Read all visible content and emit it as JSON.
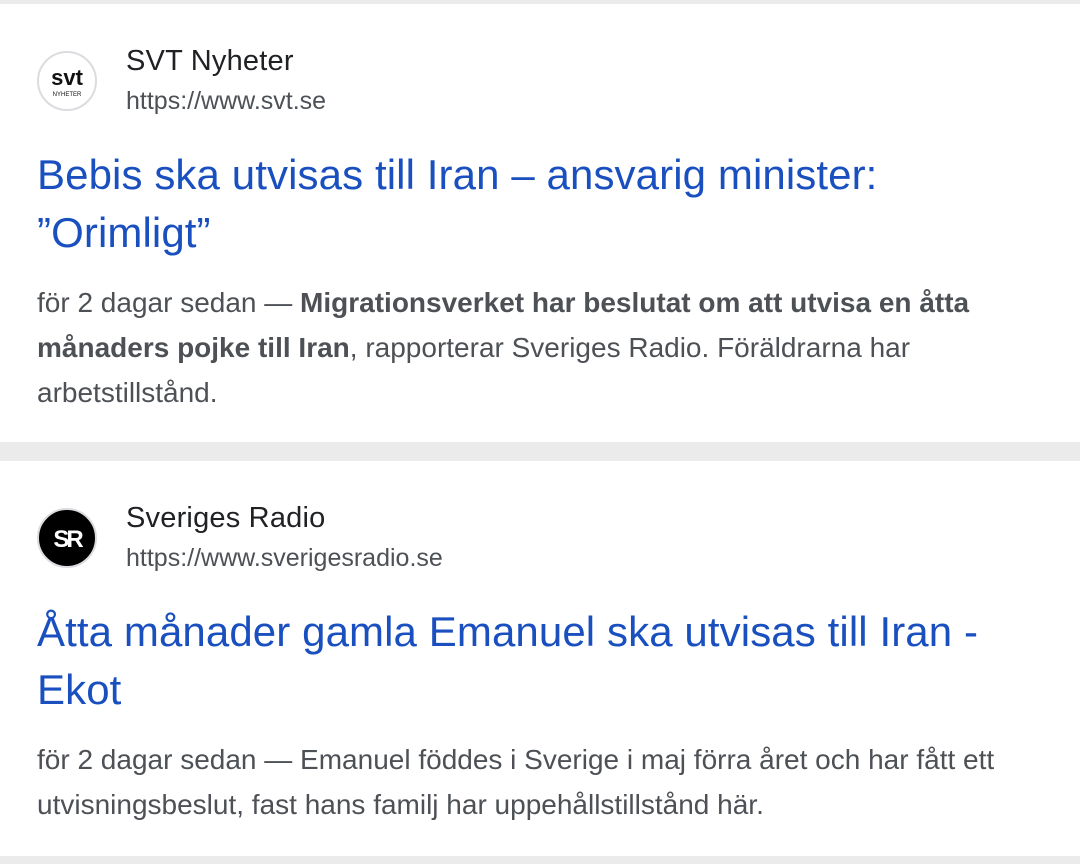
{
  "results": [
    {
      "site_name": "SVT Nyheter",
      "url": "https://www.svt.se",
      "favicon": {
        "icon": "svt-logo-icon",
        "text_main": "svt",
        "text_sub": "NYHETER"
      },
      "title_line1": "Bebis ska utvisas till Iran – ansvarig minister:",
      "title_line2": "”Orimligt”",
      "snippet": {
        "date": "för 2 dagar sedan — ",
        "bold": "Migrationsverket har beslutat om att utvisa en åtta månaders pojke till Iran",
        "rest": ", rapporterar Sveriges Radio. Föräldrarna har arbetstillstånd."
      }
    },
    {
      "site_name": "Sveriges Radio",
      "url": "https://www.sverigesradio.se",
      "favicon": {
        "icon": "sveriges-radio-logo-icon",
        "text_main": "SR"
      },
      "title_line1": "Åtta månader gamla Emanuel ska utvisas till Iran -",
      "title_line2": "Ekot",
      "snippet": {
        "date": "för 2 dagar sedan — ",
        "rest": "Emanuel föddes i Sverige i maj förra året och har fått ett utvisningsbeslut, fast hans familj har uppehållstillstånd här."
      }
    }
  ],
  "colors": {
    "link": "#1a4fbf",
    "text": "#4d5156",
    "heading": "#202124",
    "separator": "#ebebeb"
  }
}
